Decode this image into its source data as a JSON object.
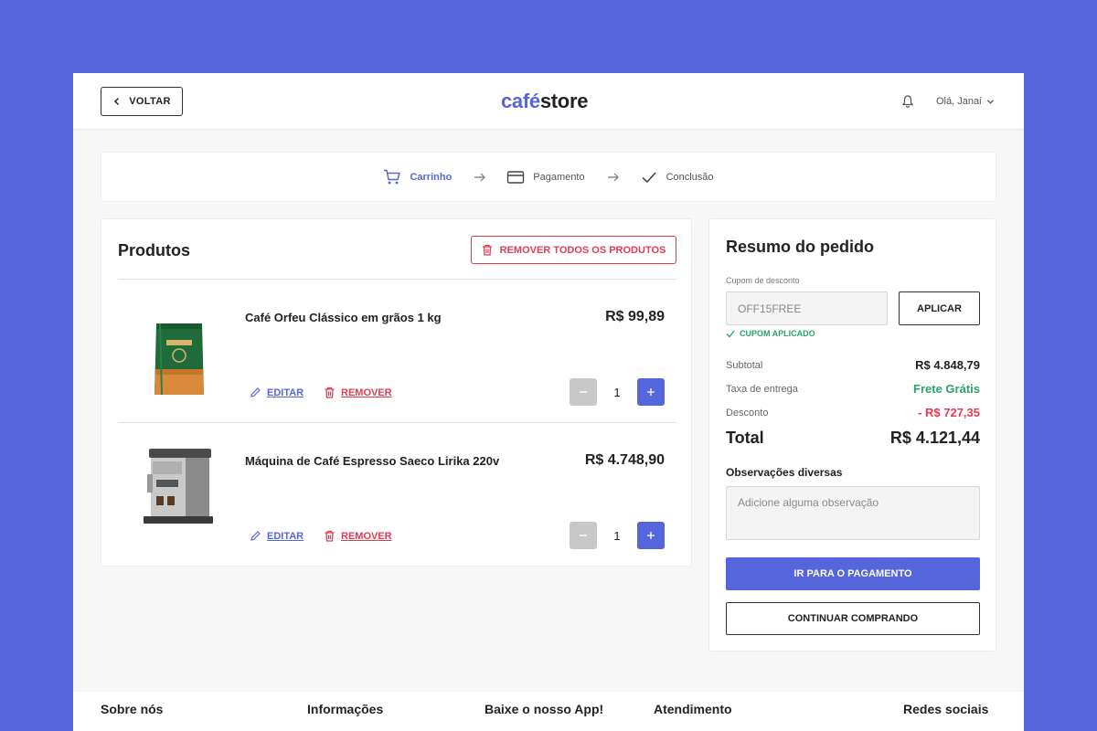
{
  "header": {
    "back_label": "VOLTAR",
    "logo_part1": "café",
    "logo_part2": "store",
    "greeting": "Olá, Janai",
    "icons": [
      "chevron-left-icon",
      "bell-icon",
      "chevron-down-icon"
    ]
  },
  "steps": [
    {
      "label": "Carrinho",
      "icon": "cart-icon",
      "active": true
    },
    {
      "label": "Pagamento",
      "icon": "card-icon",
      "active": false
    },
    {
      "label": "Conclusão",
      "icon": "check-icon",
      "active": false
    }
  ],
  "products": {
    "title": "Produtos",
    "remove_all_label": "REMOVER TODOS OS PRODUTOS",
    "edit_label": "EDITAR",
    "remove_label": "REMOVER",
    "items": [
      {
        "name": "Café Orfeu Clássico em grãos 1 kg",
        "price": "R$ 99,89",
        "quantity": "1",
        "image": "coffee-bag-image"
      },
      {
        "name": "Máquina de Café Espresso Saeco Lirika 220v",
        "price": "R$ 4.748,90",
        "quantity": "1",
        "image": "espresso-machine-image"
      }
    ]
  },
  "summary": {
    "title": "Resumo do pedido",
    "coupon_label": "Cupom de desconto",
    "coupon_value": "OFF15FREE",
    "apply_label": "APLICAR",
    "coupon_status": "CUPOM APLICADO",
    "subtotal_label": "Subtotal",
    "subtotal_value": "R$ 4.848,79",
    "shipping_label": "Taxa de entrega",
    "shipping_value": "Frete Grátis",
    "discount_label": "Desconto",
    "discount_value": "-  R$ 727,35",
    "total_label": "Total",
    "total_value": "R$ 4.121,44",
    "notes_label": "Observações diversas",
    "notes_placeholder": "Adicione alguma observação",
    "pay_label": "IR PARA O PAGAMENTO",
    "continue_label": "CONTINUAR COMPRANDO"
  },
  "footer": {
    "columns": [
      "Sobre nós",
      "Informações",
      "Baixe o nosso App!",
      "Atendimento",
      "Redes sociais"
    ]
  },
  "colors": {
    "accent": "#5566dd",
    "danger": "#e23c52",
    "success": "#2aa36b",
    "background": "#5566dd"
  }
}
